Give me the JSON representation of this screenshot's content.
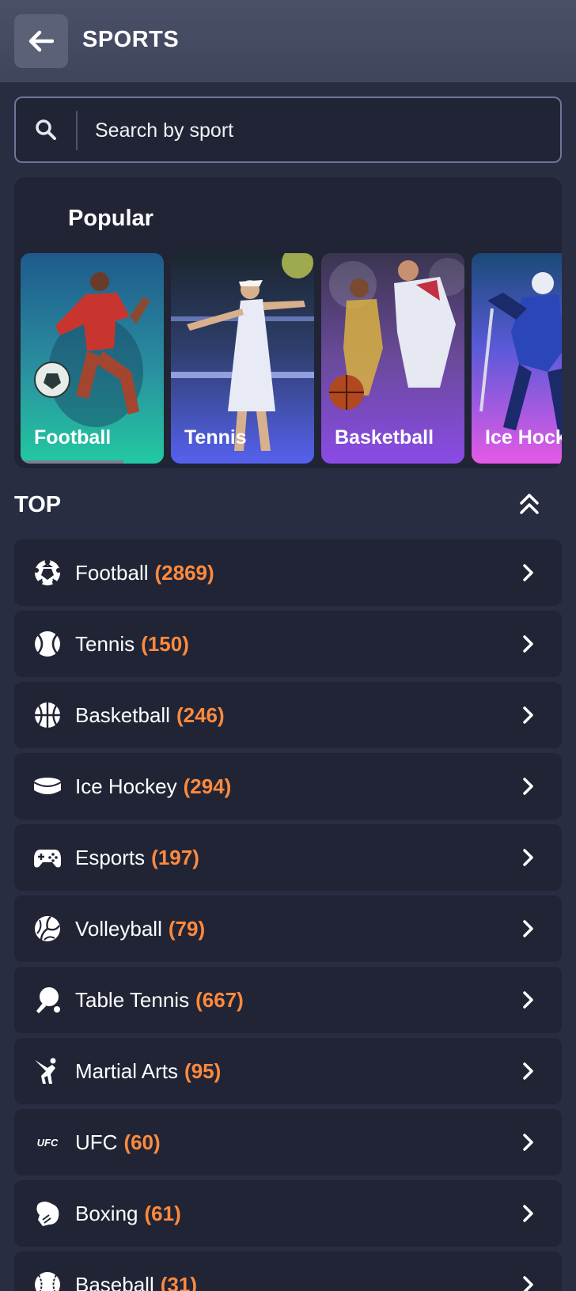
{
  "header": {
    "title": "SPORTS"
  },
  "search": {
    "placeholder": "Search by sport"
  },
  "popular": {
    "title": "Popular",
    "cards": [
      {
        "label": "Football"
      },
      {
        "label": "Tennis"
      },
      {
        "label": "Basketball"
      },
      {
        "label": "Ice Hock"
      }
    ]
  },
  "top": {
    "title": "TOP",
    "items": [
      {
        "label": "Football",
        "count": "(2869)",
        "icon": "football-icon"
      },
      {
        "label": "Tennis",
        "count": "(150)",
        "icon": "tennis-icon"
      },
      {
        "label": "Basketball",
        "count": "(246)",
        "icon": "basketball-icon"
      },
      {
        "label": "Ice Hockey",
        "count": "(294)",
        "icon": "ice-hockey-icon"
      },
      {
        "label": "Esports",
        "count": "(197)",
        "icon": "gamepad-icon"
      },
      {
        "label": "Volleyball",
        "count": "(79)",
        "icon": "volleyball-icon"
      },
      {
        "label": "Table Tennis",
        "count": "(667)",
        "icon": "table-tennis-icon"
      },
      {
        "label": "Martial Arts",
        "count": "(95)",
        "icon": "martial-arts-icon"
      },
      {
        "label": "UFC",
        "count": "(60)",
        "icon": "ufc-icon",
        "icon_text": "UFC"
      },
      {
        "label": "Boxing",
        "count": "(61)",
        "icon": "boxing-glove-icon"
      },
      {
        "label": "Baseball",
        "count": "(31)",
        "icon": "baseball-icon"
      }
    ]
  },
  "colors": {
    "background": "#282d42",
    "panel": "#212435",
    "header": "#4a5068",
    "count_accent": "#ff8a3d"
  }
}
